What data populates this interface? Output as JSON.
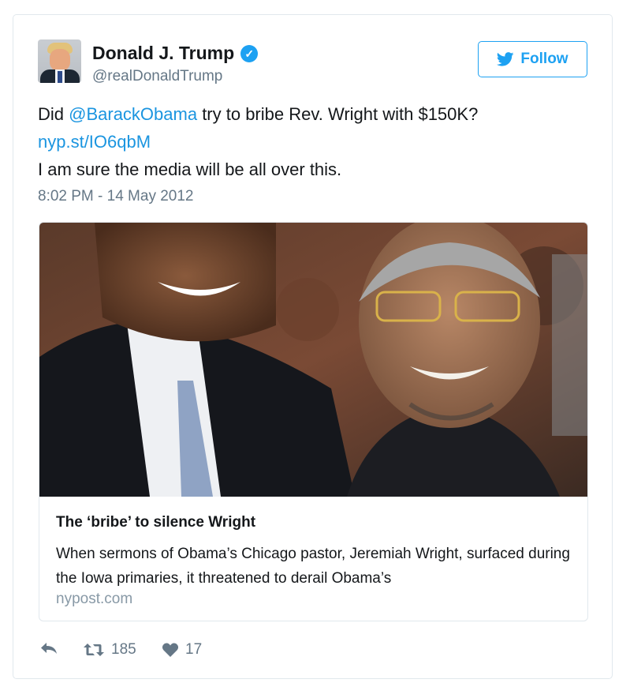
{
  "tweet": {
    "author": {
      "name": "Donald J. Trump",
      "handle": "@realDonaldTrump",
      "verified_icon": "verified-badge-icon"
    },
    "follow_button": {
      "label": "Follow",
      "icon": "twitter-bird-icon"
    },
    "text": {
      "line1_prefix": "Did ",
      "mention": "@BarackObama",
      "line1_suffix": " try to bribe Rev. Wright with $150K?",
      "link": "nyp.st/IO6qbM",
      "line3": "I am sure the media will be all over this."
    },
    "timestamp": "8:02 PM - 14 May 2012",
    "card": {
      "title": "The ‘bribe’ to silence Wright",
      "description": "When sermons of Obama’s Chicago pastor, Jeremiah Wright, surfaced during the Iowa primaries, it threatened to derail Obama’s",
      "domain": "nypost.com"
    },
    "actions": {
      "reply_icon": "reply-icon",
      "retweet_icon": "retweet-icon",
      "retweet_count": "185",
      "like_icon": "heart-icon",
      "like_count": "17"
    }
  },
  "colors": {
    "accent": "#1da1f2",
    "link": "#1b95e0",
    "secondary_text": "#657786",
    "border": "#e1e8ed"
  }
}
